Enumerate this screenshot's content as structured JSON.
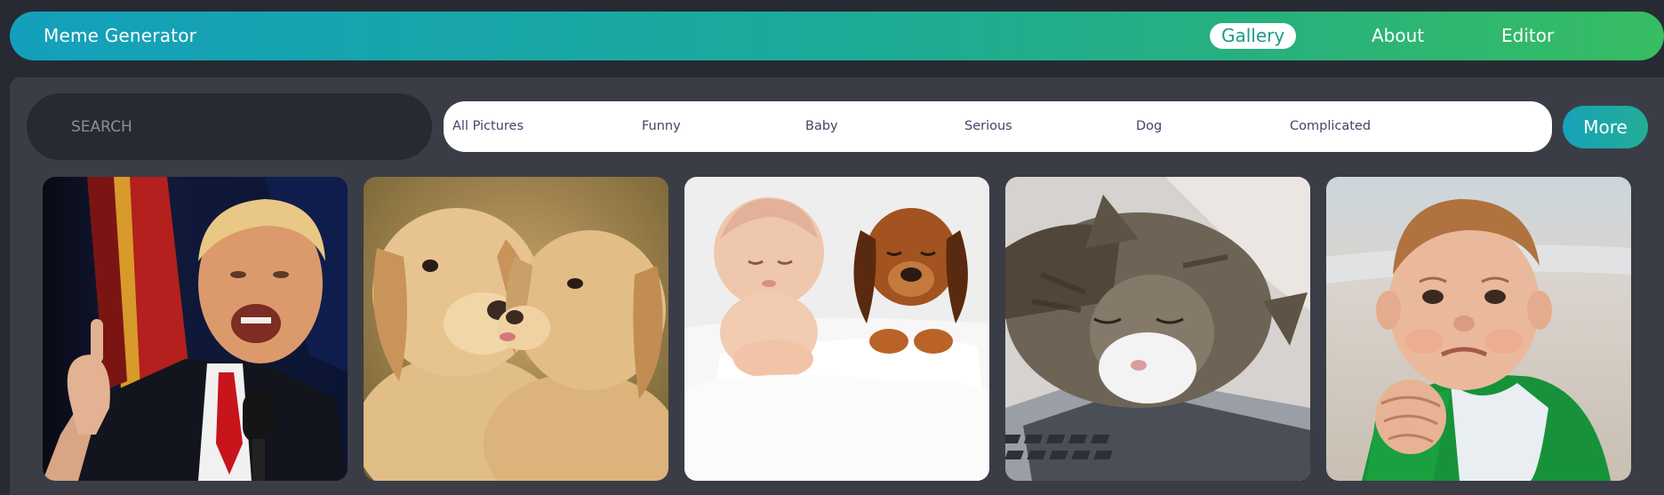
{
  "app": {
    "title": "Meme Generator"
  },
  "nav": {
    "items": [
      {
        "label": "Gallery",
        "active": true
      },
      {
        "label": "About",
        "active": false
      },
      {
        "label": "Editor",
        "active": false
      }
    ]
  },
  "search": {
    "placeholder": "SEARCH",
    "value": ""
  },
  "filters": {
    "items": [
      {
        "label": "All Pictures"
      },
      {
        "label": "Funny"
      },
      {
        "label": "Baby"
      },
      {
        "label": "Serious"
      },
      {
        "label": "Dog"
      },
      {
        "label": "Complicated"
      }
    ],
    "more_label": "More"
  },
  "gallery": {
    "images": [
      {
        "subject": "man-speaking-at-microphone"
      },
      {
        "subject": "two-puppies-kissing"
      },
      {
        "subject": "sleeping-baby-and-puppy"
      },
      {
        "subject": "cat-sleeping-on-laptop"
      },
      {
        "subject": "success-kid-fist"
      }
    ]
  },
  "colors": {
    "page_background": "#272a33",
    "panel_background": "#3a3d46",
    "header_gradient_start": "#14a0bc",
    "header_gradient_end": "#37bd62",
    "filter_text": "#4d3e6c",
    "active_nav_text": "#1f9a8c"
  }
}
